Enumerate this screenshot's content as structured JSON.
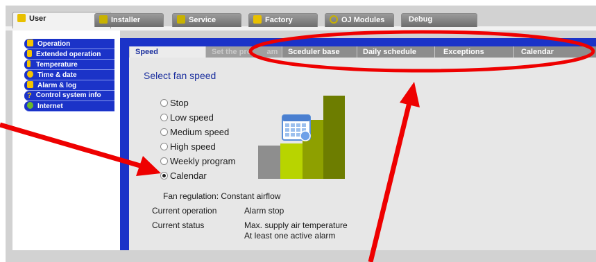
{
  "top_tabs": [
    {
      "label": "User",
      "icon": "users-icon",
      "color": "#e8c000"
    },
    {
      "label": "Installer",
      "icon": "wrench-icon",
      "color": "#c8b200"
    },
    {
      "label": "Service",
      "icon": "tools-icon",
      "color": "#c8b200"
    },
    {
      "label": "Factory",
      "icon": "factory-icon",
      "color": "#e8c000"
    },
    {
      "label": "OJ Modules",
      "icon": "modules-icon",
      "color": "#c8b200"
    },
    {
      "label": "Debug",
      "icon": "",
      "color": ""
    }
  ],
  "sidebar": {
    "items": [
      {
        "label": "Operation",
        "icon": "fan-icon"
      },
      {
        "label": "Extended operation",
        "icon": "hourglass-icon"
      },
      {
        "label": "Temperature",
        "icon": "thermometer-icon"
      },
      {
        "label": "Time & date",
        "icon": "clock-icon"
      },
      {
        "label": "Alarm & log",
        "icon": "bell-icon"
      },
      {
        "label": "Control system info",
        "icon": "question-icon"
      },
      {
        "label": "Internet",
        "icon": "globe-icon"
      }
    ]
  },
  "sub_tabs": [
    {
      "label": "Speed"
    },
    {
      "label": "Set the pro"
    },
    {
      "label": "am"
    },
    {
      "label": "Sceduler base"
    },
    {
      "label": "Daily schedule"
    },
    {
      "label": "Exceptions"
    },
    {
      "label": "Calendar"
    }
  ],
  "main": {
    "heading": "Select fan speed",
    "options": [
      {
        "label": "Stop",
        "selected": false
      },
      {
        "label": "Low speed",
        "selected": false
      },
      {
        "label": "Medium speed",
        "selected": false
      },
      {
        "label": "High speed",
        "selected": false
      },
      {
        "label": "Weekly program",
        "selected": false
      },
      {
        "label": "Calendar",
        "selected": true
      }
    ],
    "fan_regulation": "Fan regulation: Constant airflow",
    "current_operation_label": "Current operation",
    "current_operation_value": "Alarm stop",
    "current_status_label": "Current status",
    "current_status_line1": "Max. supply air temperature",
    "current_status_line2": "At least one active alarm"
  },
  "colors": {
    "accent_blue": "#1b33c8",
    "annotation_red": "#ee0000",
    "bar_gray": "#8e8e8e",
    "bar_lime": "#b8d400",
    "bar_olive": "#8ea000",
    "bar_dark_olive": "#6d7d00"
  }
}
